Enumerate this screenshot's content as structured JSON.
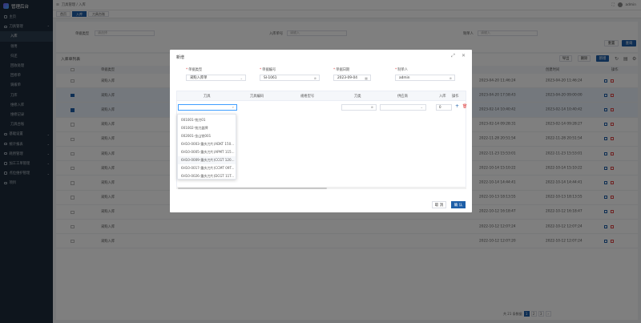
{
  "app": {
    "title": "管理后台"
  },
  "sidebar": {
    "items": [
      {
        "label": "主页"
      },
      {
        "label": "刀具管理",
        "expanded": true
      },
      {
        "label": "入库",
        "sub": true,
        "active": true
      },
      {
        "label": "领用",
        "sub": true
      },
      {
        "label": "归还",
        "sub": true
      },
      {
        "label": "回收处理",
        "sub": true
      },
      {
        "label": "回修单",
        "sub": true
      },
      {
        "label": "调拨单",
        "sub": true
      },
      {
        "label": "刀库",
        "sub": true
      },
      {
        "label": "维修入库",
        "sub": true
      },
      {
        "label": "维修记录",
        "sub": true
      },
      {
        "label": "刀具台账",
        "sub": true
      },
      {
        "label": "基础设置"
      },
      {
        "label": "统计报表"
      },
      {
        "label": "耗用管理"
      },
      {
        "label": "加工工单管理"
      },
      {
        "label": "点位维护管理"
      },
      {
        "label": "项目"
      }
    ]
  },
  "topbar": {
    "breadcrumb": "刀具管理 / 入库",
    "user": "admin"
  },
  "tabs": [
    {
      "label": "首页"
    },
    {
      "label": "入库",
      "active": true
    },
    {
      "label": "刀具台账"
    }
  ],
  "filter": {
    "type_label": "单据类型",
    "type_placeholder": "请选择",
    "no_label": "入库单号",
    "no_placeholder": "请输入",
    "date_label": "制单人",
    "date_placeholder": "请输入",
    "reset": "重置",
    "search": "查询"
  },
  "list": {
    "title": "入库单列表",
    "btn_export": "导出",
    "btn_delete": "删除",
    "btn_add": "新增",
    "col_type": "单据类型",
    "col_date": "创建时间",
    "col_ops": "操作",
    "rows": [
      {
        "type": "采购入库",
        "date1": "2023-04-20 11:46:24",
        "date2": "2023-04-20 11:46:24",
        "sel": false
      },
      {
        "type": "采购入库",
        "date1": "2023-04-20 17:58:43",
        "date2": "2023-04-20 09:00:00",
        "sel": true
      },
      {
        "type": "采购入库",
        "date1": "2023-02-14 10:40:42",
        "date2": "2023-02-14 10:40:42",
        "sel": true
      },
      {
        "type": "采购入库",
        "date1": "2023-02-14 09:28:31",
        "date2": "2023-02-14 09:28:27",
        "sel": false
      },
      {
        "type": "采购入库",
        "date1": "2022-11-28 20:51:54",
        "date2": "2022-11-28 20:51:54",
        "sel": false
      },
      {
        "type": "采购入库",
        "date1": "2022-11-23 15:53:01",
        "date2": "2022-11-23 15:53:01",
        "sel": false
      },
      {
        "type": "采购入库",
        "date1": "2022-10-14 15:10:22",
        "date2": "2022-10-14 15:10:22",
        "sel": false
      },
      {
        "type": "采购入库",
        "date1": "2022-10-14 14:44:41",
        "date2": "2022-10-14 14:44:41",
        "sel": false
      },
      {
        "type": "采购入库",
        "date1": "2022-10-13 18:13:55",
        "date2": "2022-10-13 18:13:55",
        "sel": false
      },
      {
        "type": "采购入库",
        "date1": "2022-10-12 16:18:47",
        "date2": "2022-10-12 16:18:47",
        "sel": false
      },
      {
        "type": "采购入库",
        "date1": "2022-10-12 12:07:24",
        "date2": "2022-10-12 12:07:24",
        "sel": false
      },
      {
        "type": "采购入库",
        "date1": "2022-10-12 12:07:20",
        "date2": "2022-10-12 12:07:24",
        "sel": false
      }
    ],
    "pager_total": "共 21 条数据",
    "pages": [
      "1",
      "2",
      "3"
    ],
    "next": "›"
  },
  "modal": {
    "title": "新增",
    "fields": {
      "type_label": "单据类型",
      "type_value": "采购入库单",
      "no_label": "单据编号",
      "no_value": "SI-1061",
      "date_label": "单据日期",
      "date_value": "2023-09-04",
      "maker_label": "制单人",
      "maker_value": "admin"
    },
    "table": {
      "cols": [
        "刀具",
        "刀具编码",
        "规格型号",
        "刀类",
        "供应商",
        "入库",
        "操作"
      ],
      "qty": "0"
    },
    "dropdown": [
      "001001-铣刀01",
      "001002-铣刀盖牌",
      "002001-金山铣001",
      "6H10-0003-重庆刀片(ADKT 150...",
      "6H10-0005-重庆刀片(APMT 115...",
      "6H10-0009-重庆刀片(CCGT 120...",
      "6H10-0017-重庆刀片(CCMT 09T...",
      "6H10-0026-重庆刀片(DCGT 11T..."
    ],
    "cancel": "取 消",
    "confirm": "确 认"
  },
  "colors": {
    "primary": "#1e5fa8",
    "sidebar": "#1d2b3a",
    "danger": "#e04848"
  }
}
